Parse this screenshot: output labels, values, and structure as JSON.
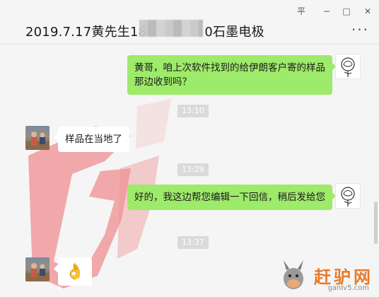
{
  "window": {
    "title": "2019.7.17黄先生18",
    "title_suffix": "0石墨电极",
    "controls": {
      "pin": "平",
      "minimize": "−",
      "maximize": "□",
      "close": "✕"
    },
    "more_label": "···"
  },
  "messages": [
    {
      "type": "text",
      "side": "me",
      "text": "黄哥，咱上次软件找到的给伊朗客户寄的样品那边收到吗？"
    },
    {
      "type": "time",
      "text": "13:10"
    },
    {
      "type": "text",
      "side": "peer",
      "text": "样品在当地了"
    },
    {
      "type": "time",
      "text": "13:29"
    },
    {
      "type": "text",
      "side": "me",
      "text": "好的，我这边帮您编辑一下回信，稍后发给您"
    },
    {
      "type": "time",
      "text": "13:37"
    },
    {
      "type": "emoji",
      "side": "peer",
      "emoji": "👌"
    }
  ],
  "watermark": {
    "brand": "赶驴网",
    "url": "ganlv5.com"
  },
  "colors": {
    "my_bubble": "#9eea6a",
    "peer_bubble": "#ffffff",
    "background": "#f5f5f5",
    "watermark_accent": "#e87a2a"
  }
}
